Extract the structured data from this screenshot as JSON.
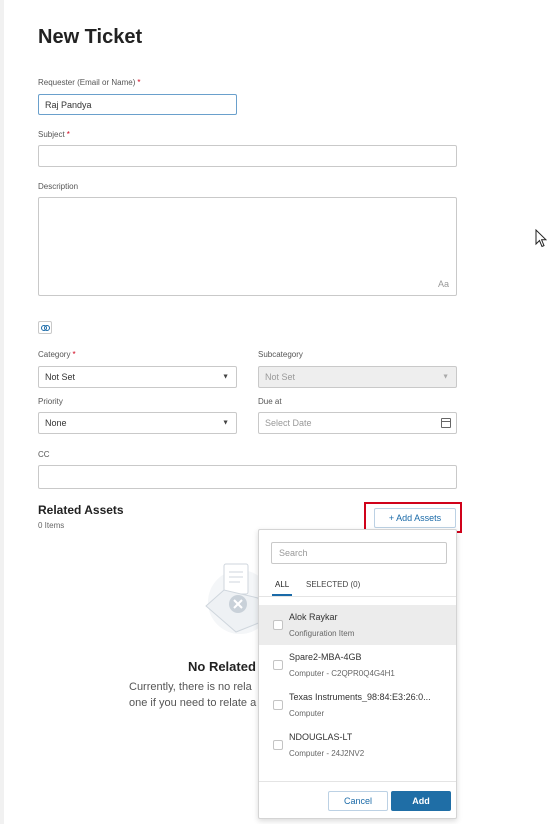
{
  "page": {
    "title": "New Ticket"
  },
  "form": {
    "requester": {
      "label": "Requester (Email or Name)",
      "required_mark": "*",
      "value": "Raj Pandya"
    },
    "subject": {
      "label": "Subject",
      "required_mark": "*",
      "value": ""
    },
    "description": {
      "label": "Description",
      "value": "",
      "format_icon": "Aa"
    },
    "category": {
      "label": "Category",
      "required_mark": "*",
      "value": "Not Set"
    },
    "subcategory": {
      "label": "Subcategory",
      "value": "Not Set",
      "disabled": true
    },
    "priority": {
      "label": "Priority",
      "value": "None"
    },
    "due_at": {
      "label": "Due at",
      "placeholder": "Select Date"
    },
    "cc": {
      "label": "CC",
      "value": ""
    }
  },
  "related_assets": {
    "title": "Related Assets",
    "count_text": "0 Items",
    "add_button": "+ Add Assets",
    "empty_title": "No Related",
    "empty_text_1": "Currently, there is no rela",
    "empty_text_2": "one if you need to relate a"
  },
  "asset_picker": {
    "search_placeholder": "Search",
    "tabs": [
      {
        "label": "ALL",
        "active": true
      },
      {
        "label": "SELECTED (0)",
        "active": false
      }
    ],
    "items": [
      {
        "name": "Alok Raykar",
        "sub": "Configuration Item"
      },
      {
        "name": "Spare2-MBA-4GB",
        "sub": "Computer - C2QPR0Q4G4H1"
      },
      {
        "name": "Texas Instruments_98:84:E3:26:0...",
        "sub": "Computer"
      },
      {
        "name": "NDOUGLAS-LT",
        "sub": "Computer - 24J2NV2"
      }
    ],
    "cancel_label": "Cancel",
    "add_label": "Add"
  },
  "icons": {
    "dropdown_caret": "caret-down-icon",
    "link": "link-icon",
    "calendar": "calendar-icon",
    "cursor": "mouse-pointer-icon"
  },
  "colors": {
    "accent": "#1a6aa8",
    "primary_button": "#1f6ea6",
    "required": "#d0021b",
    "highlight_box": "#d0021b"
  }
}
